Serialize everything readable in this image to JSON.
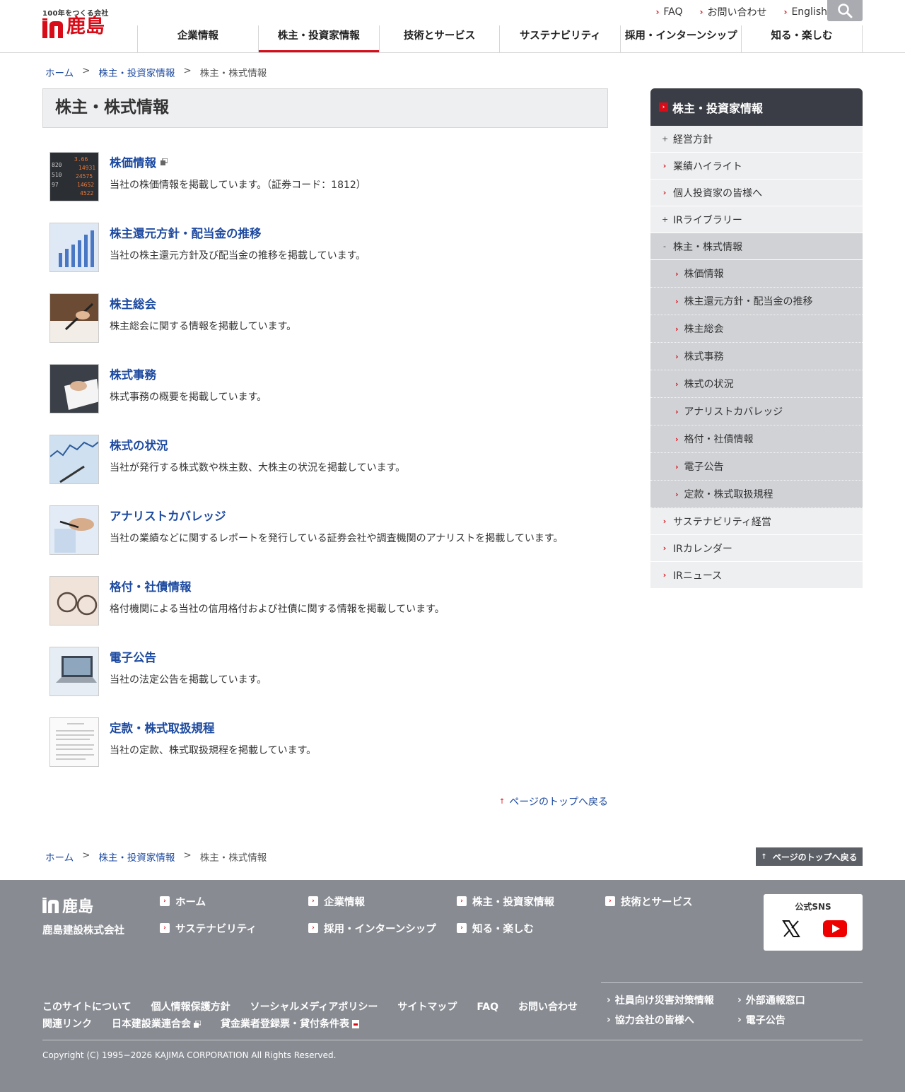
{
  "header": {
    "logo_tagline": "100年をつくる会社",
    "logo_name": "鹿島",
    "util_nav": [
      "FAQ",
      "お問い合わせ",
      "English"
    ],
    "main_nav": [
      "企業情報",
      "株主・投資家情報",
      "技術とサービス",
      "サステナビリティ",
      "採用・インターンシップ",
      "知る・楽しむ"
    ]
  },
  "breadcrumb": {
    "home": "ホーム",
    "parent": "株主・投資家情報",
    "current": "株主・株式情報",
    "separator": ">"
  },
  "page": {
    "title": "株主・株式情報"
  },
  "items": [
    {
      "title": "株価情報",
      "desc": "当社の株価情報を掲載しています。（証券コード：1812）"
    },
    {
      "title": "株主還元方針・配当金の推移",
      "desc": "当社の株主還元方針及び配当金の推移を掲載しています。"
    },
    {
      "title": "株主総会",
      "desc": "株主総会に関する情報を掲載しています。"
    },
    {
      "title": "株式事務",
      "desc": "株式事務の概要を掲載しています。"
    },
    {
      "title": "株式の状況",
      "desc": "当社が発行する株式数や株主数、大株主の状況を掲載しています。"
    },
    {
      "title": "アナリストカバレッジ",
      "desc": "当社の業績などに関するレポートを発行している証券会社や調査機関のアナリストを掲載しています。"
    },
    {
      "title": "格付・社債情報",
      "desc": "格付機関による当社の信用格付および社債に関する情報を掲載しています。"
    },
    {
      "title": "電子公告",
      "desc": "当社の法定公告を掲載しています。"
    },
    {
      "title": "定款・株式取扱規程",
      "desc": "当社の定款、株式取扱規程を掲載しています。"
    }
  ],
  "back_to_top": "ページのトップへ戻る",
  "top_button": "ページのトップへ戻る",
  "side": {
    "heading": "株主・投資家情報",
    "items_before": [
      {
        "label": "経営方針",
        "mark": "+"
      },
      {
        "label": "業績ハイライト",
        "mark": "›"
      },
      {
        "label": "個人投資家の皆様へ",
        "mark": "›"
      },
      {
        "label": "IRライブラリー",
        "mark": "+"
      }
    ],
    "open_item": {
      "label": "株主・株式情報",
      "mark": "-"
    },
    "sub_items": [
      "株価情報",
      "株主還元方針・配当金の推移",
      "株主総会",
      "株式事務",
      "株式の状況",
      "アナリストカバレッジ",
      "格付・社債情報",
      "電子公告",
      "定款・株式取扱規程"
    ],
    "items_after": [
      "サステナビリティ経営",
      "IRカレンダー",
      "IRニュース"
    ]
  },
  "footer": {
    "logo_name": "鹿島",
    "company": "鹿島建設株式会社",
    "nav": [
      "ホーム",
      "企業情報",
      "株主・投資家情報",
      "技術とサービス",
      "サステナビリティ",
      "採用・インターンシップ",
      "知る・楽しむ"
    ],
    "sns_title": "公式SNS",
    "links_row1": [
      "このサイトについて",
      "個人情報保護方針",
      "ソーシャルメディアポリシー",
      "サイトマップ",
      "FAQ",
      "お問い合わせ"
    ],
    "links_row2": [
      "関連リンク",
      "日本建設業連合会",
      "貸金業者登録票・貸付条件表"
    ],
    "right_links": [
      "社員向け災害対策情報",
      "外部通報窓口",
      "協力会社の皆様へ",
      "電子公告"
    ],
    "copyright": "Copyright (C) 1995−2026 KAJIMA CORPORATION All Rights Reserved."
  },
  "colors": {
    "brand_red": "#d70c18",
    "link_blue": "#1d4aa0",
    "side_head": "#3a3d45",
    "footer_bg": "#888b92"
  }
}
